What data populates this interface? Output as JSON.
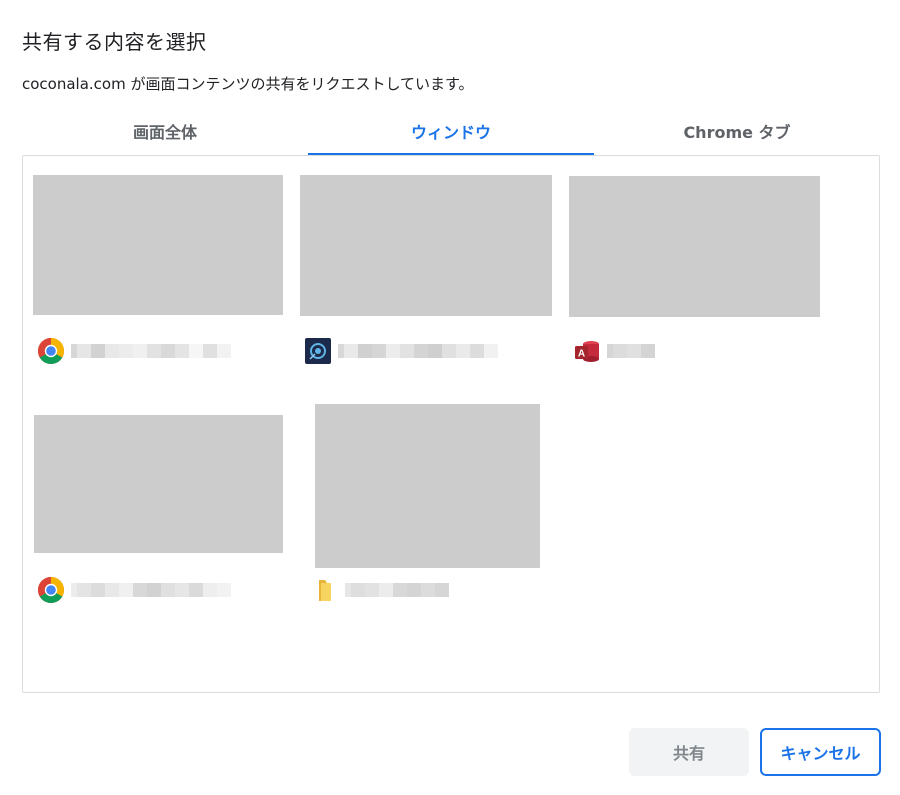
{
  "dialog": {
    "title": "共有する内容を選択",
    "subtitle": "coconala.com が画面コンテンツの共有をリクエストしています。"
  },
  "tabs": [
    {
      "label": "画面全体",
      "active": false
    },
    {
      "label": "ウィンドウ",
      "active": true
    },
    {
      "label": "Chrome タブ",
      "active": false
    }
  ],
  "windows": [
    {
      "app_icon": "chrome-icon"
    },
    {
      "app_icon": "photo-director-icon"
    },
    {
      "app_icon": "ms-access-icon"
    },
    {
      "app_icon": "chrome-icon"
    },
    {
      "app_icon": "folder-icon"
    }
  ],
  "buttons": {
    "share_label": "共有",
    "cancel_label": "キャンセル"
  },
  "colors": {
    "accent": "#1a73e8",
    "thumbnail": "#cccccc",
    "border": "#dadce0",
    "disabled_button_bg": "#f1f3f4"
  }
}
